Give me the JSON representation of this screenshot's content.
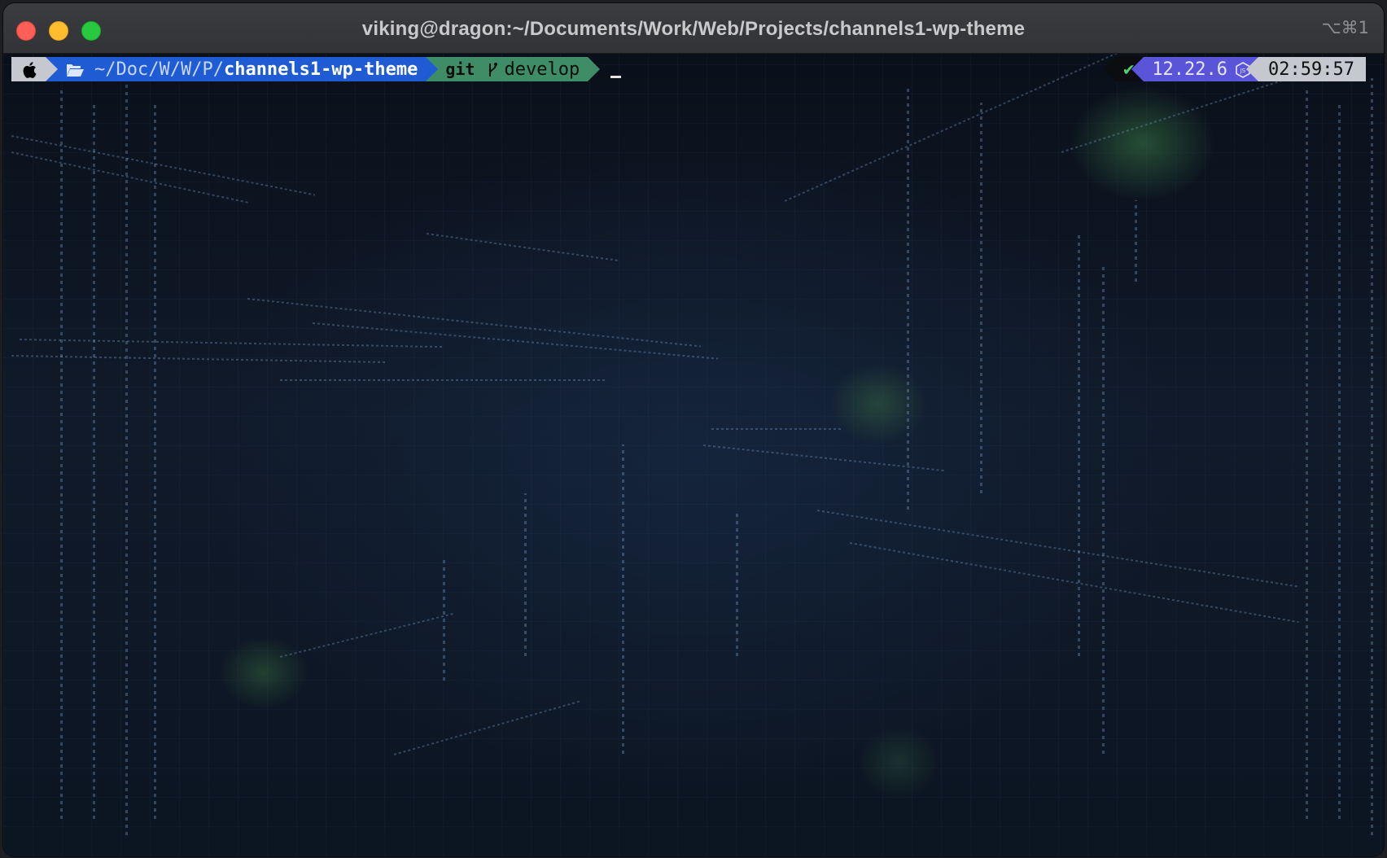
{
  "window": {
    "title": "viking@dragon:~/Documents/Work/Web/Projects/channels1-wp-theme",
    "shortcut": "⌥⌘1"
  },
  "prompt": {
    "os_icon": "apple-icon",
    "folder_icon": "folder-open-icon",
    "path_prefix": "~/Doc/W/W/P/",
    "path_current": "channels1-wp-theme",
    "vcs_label": "git",
    "branch_icon": "git-branch-icon",
    "branch": "develop"
  },
  "right_prompt": {
    "status_symbol": "✔",
    "node_version": "12.22.6",
    "node_icon": "nodejs-icon",
    "time": "02:59:57"
  },
  "colors": {
    "path_segment": "#1f5bd3",
    "git_segment": "#3f8d67",
    "node_segment": "#5a54d9",
    "light_segment": "#c5c8ce",
    "status_ok": "#4fd36f"
  }
}
